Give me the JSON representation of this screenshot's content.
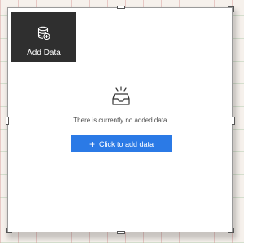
{
  "widget": {
    "tile": {
      "label": "Add Data",
      "icon": "database-plus-icon",
      "background": "#2f2f2f"
    },
    "empty_state": {
      "icon": "empty-inbox-icon",
      "message": "There is currently no added data."
    },
    "add_button": {
      "icon": "plus-icon",
      "icon_glyph": "+",
      "label": "Click to add data",
      "color": "#2b7ae6"
    }
  }
}
